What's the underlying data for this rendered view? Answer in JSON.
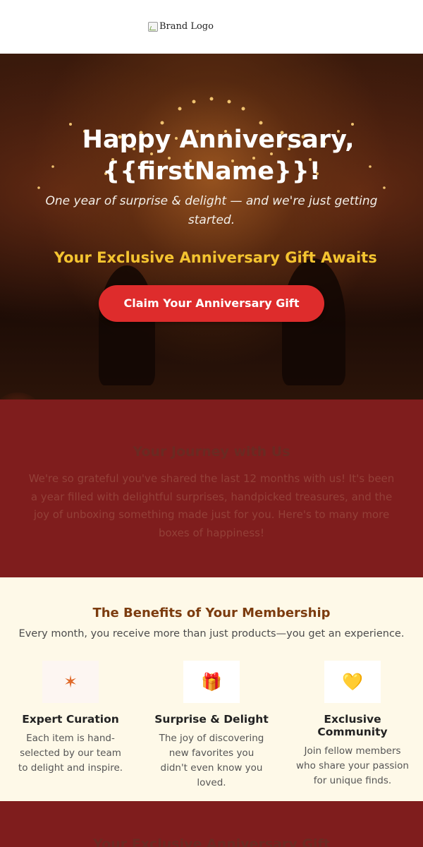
{
  "header": {
    "logo_alt": "Brand Logo"
  },
  "hero": {
    "title_line1": "  Happy Anniversary,",
    "title_line2": "{{firstName}}!",
    "subtitle": "One year of surprise & delight — and we're just getting started.",
    "gift_line": "  Your Exclusive Anniversary Gift Awaits",
    "cta_label": "  Claim Your Anniversary Gift  "
  },
  "journey": {
    "title": "Your Journey with Us",
    "text": "We're so grateful you've shared the last 12 months with us! It's been a year filled with delightful surprises, handpicked treasures, and the joy of unboxing something made just for you. Here's to many more boxes of happiness!"
  },
  "benefits": {
    "title": "The Benefits of Your Membership",
    "subtitle": "Every month, you receive more than just products—you get an experience.",
    "items": [
      {
        "icon": "sparkle-icon",
        "glyph": "✶",
        "title": "Expert Curation",
        "text": "Each item is hand-selected by our team to delight and inspire."
      },
      {
        "icon": "gift-icon",
        "glyph": "🎁",
        "title": "Surprise & Delight",
        "text": "The joy of discovering new favorites you didn't even know you loved."
      },
      {
        "icon": "heart-icon",
        "glyph": "💛",
        "title": "Exclusive Community",
        "text": "Join fellow members who share your passion for unique finds."
      }
    ]
  },
  "gift_section": {
    "title": "Your Exclusive Anniversary Gift"
  },
  "colors": {
    "cta": "#de2c2c",
    "gold": "#f4c430",
    "burgundy": "#7f1d1d",
    "cream": "#fef9e8",
    "heading_brown": "#7c3c0f"
  }
}
